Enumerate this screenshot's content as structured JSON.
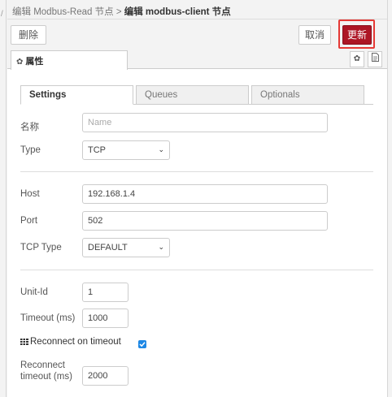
{
  "breadcrumb": {
    "prefix": "编辑 Modbus-Read 节点 > ",
    "current": "编辑 modbus-client 节点"
  },
  "toolbar": {
    "delete_label": "删除",
    "cancel_label": "取消",
    "update_label": "更新"
  },
  "tabs": {
    "properties_label": "属性"
  },
  "subtabs": [
    "Settings",
    "Queues",
    "Optionals"
  ],
  "form": {
    "name": {
      "label": "名称",
      "placeholder": "Name",
      "value": ""
    },
    "type": {
      "label": "Type",
      "value": "TCP"
    },
    "host": {
      "label": "Host",
      "value": "192.168.1.4"
    },
    "port": {
      "label": "Port",
      "value": "502"
    },
    "tcp_type": {
      "label": "TCP Type",
      "value": "DEFAULT"
    },
    "unit_id": {
      "label": "Unit-Id",
      "value": "1"
    },
    "timeout": {
      "label": "Timeout (ms)",
      "value": "1000"
    },
    "reconnect_on_timeout": {
      "label": "Reconnect on timeout",
      "checked": true
    },
    "reconnect_timeout": {
      "label_line1": "Reconnect",
      "label_line2": "timeout (ms)",
      "value": "2000"
    }
  },
  "colors": {
    "update_button": "#ad1625",
    "highlight_outline": "#e53935",
    "checkbox": "#1e88e5"
  }
}
